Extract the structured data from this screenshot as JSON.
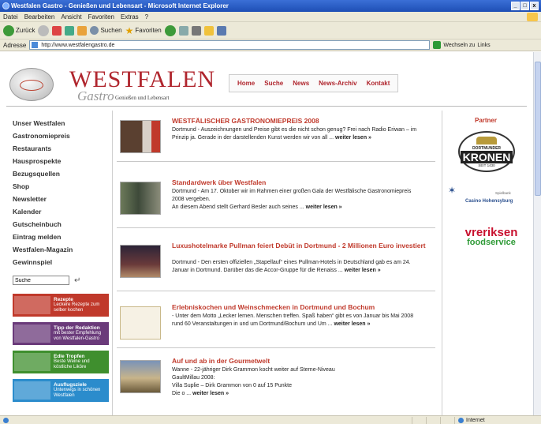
{
  "window": {
    "title": "Westfalen Gastro - Genießen und Lebensart - Microsoft Internet Explorer",
    "buttons": [
      "_",
      "□",
      "x"
    ]
  },
  "menu": [
    "Datei",
    "Bearbeiten",
    "Ansicht",
    "Favoriten",
    "Extras",
    "?"
  ],
  "toolbar": {
    "back": "Zurück",
    "search": "Suchen",
    "favorites": "Favoriten"
  },
  "address": {
    "label": "Adresse",
    "url": "http://www.westfalengastro.de",
    "go": "Wechseln zu",
    "links": "Links"
  },
  "status": {
    "zone": "Internet"
  },
  "site": {
    "brand": "WESTFALEN",
    "brand_sub": "Gastro",
    "tagline": "Genießen und Lebensart",
    "topnav": [
      "Home",
      "Suche",
      "News",
      "News-Archiv",
      "Kontakt"
    ],
    "leftnav": [
      "Unser Westfalen",
      "Gastronomiepreis",
      "Restaurants",
      "Hausprospekte",
      "Bezugsquellen",
      "Shop",
      "Newsletter",
      "Kalender",
      "Gutscheinbuch",
      "Eintrag melden",
      "Westfalen-Magazin",
      "Gewinnspiel"
    ],
    "search_value": "Suche",
    "promos": [
      {
        "title": "Rezepte",
        "text": "Leckere Rezepte zum selber kochen"
      },
      {
        "title": "Tipp der Redaktion",
        "text": "mit bester Empfehlung von Westfalen-Gastro"
      },
      {
        "title": "Edle Tropfen",
        "text": "Beste Weine und köstliche Liköre"
      },
      {
        "title": "Ausflugsziele",
        "text": "Unterwegs in schönen Westfalen"
      }
    ],
    "partner_title": "Partner",
    "partners": {
      "kronen_top": "DORTMUNDER",
      "kronen_main": "KRONEN",
      "kronen_sub": "SEIT 1430",
      "casino_top": "Spielbank",
      "casino_main": "Casino Hohensyburg",
      "vreriksen": "vreriksen",
      "foodservice": "foodservice"
    },
    "articles": [
      {
        "title": "WESTFÄLISCHER GASTRONOMIEPREIS 2008",
        "lines": [
          "Dortmund - Auszeichnungen und Preise gibt es die nicht schon genug? Frei nach Radio Eriwan – im",
          "Prinzip ja. Gerade in der darstellenden Kunst werden wir von all ..."
        ],
        "more": "weiter lesen »"
      },
      {
        "title": "Standardwerk über Westfalen",
        "lines": [
          "Dortmund - Am 17. Oktober wir im Rahmen einer großen Gala der Westfälische Gastronomiepreis",
          "2008 vergeben.",
          "An diesem Abend stellt Gerhard Besler auch seines ..."
        ],
        "more": "weiter lesen »"
      },
      {
        "title": "Luxushotelmarke Pullman feiert Debüt in Dortmund - 2 Millionen Euro investiert",
        "lines": [
          "Dortmund - Den ersten offiziellen „Stapellauf“ eines Pullman-Hotels in Deutschland gab es am 24.",
          "Januar in Dortmund. Darüber das die Accor-Gruppe für die Renaiss ..."
        ],
        "more": "weiter lesen »"
      },
      {
        "title": "Erlebniskochen und Weinschmecken in Dortmund und Bochum",
        "lines": [
          "- Unter dem Motto „Lecker lernen. Menschen treffen. Spaß haben“ gibt es von Januar bis Mai 2008",
          "rund 60 Veranstaltungen in und um Dortmund/Bochum und Um ..."
        ],
        "more": "weiter lesen »"
      },
      {
        "title": "Auf und ab in der Gourmetwelt",
        "lines": [
          "Wanne - 22-jähriger Dirk Grammon kocht weiter auf Sterne-Niveau",
          "GaultMillau 2008:",
          "Villa Suplie – Dirk Grammon von 0 auf 15 Punkte",
          "Die o ..."
        ],
        "more": "weiter lesen »"
      }
    ]
  }
}
